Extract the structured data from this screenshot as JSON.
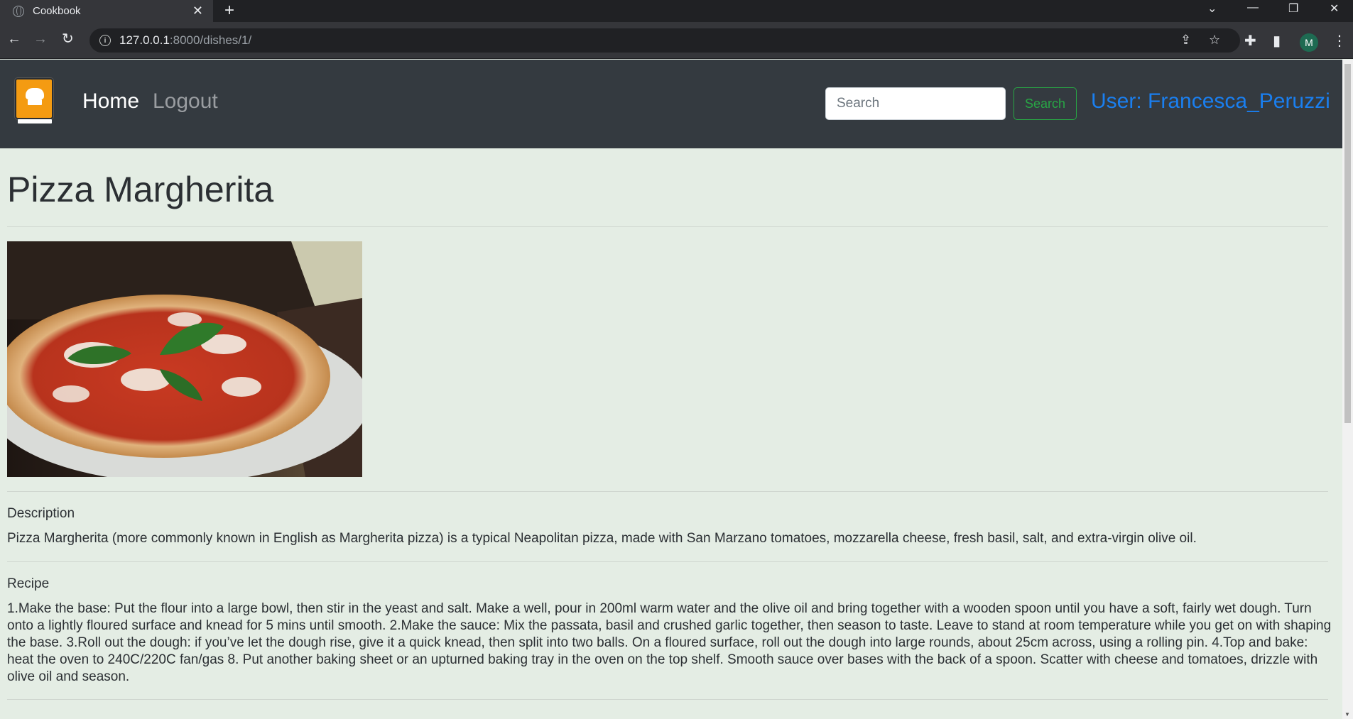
{
  "browser": {
    "tab_title": "Cookbook",
    "tab_close": "✕",
    "new_tab": "+",
    "url_host": "127.0.0.1",
    "url_rest": ":8000/dishes/1/",
    "profile_initial": "M",
    "controls": {
      "minimize": "—",
      "maximize": "❐",
      "close": "✕",
      "tab_search": "⌄"
    }
  },
  "navbar": {
    "home_label": "Home",
    "logout_label": "Logout",
    "search_placeholder": "Search",
    "search_button_label": "Search",
    "user_label": "User: Francesca_Peruzzi"
  },
  "dish": {
    "title": "Pizza Margherita",
    "description_label": "Description",
    "description_text": "Pizza Margherita (more commonly known in English as Margherita pizza) is a typical Neapolitan pizza, made with San Marzano tomatoes, mozzarella cheese, fresh basil, salt, and extra-virgin olive oil.",
    "recipe_label": "Recipe",
    "recipe_text": "1.Make the base: Put the flour into a large bowl, then stir in the yeast and salt. Make a well, pour in 200ml warm water and the olive oil and bring together with a wooden spoon until you have a soft, fairly wet dough. Turn onto a lightly floured surface and knead for 5 mins until smooth. 2.Make the sauce: Mix the passata, basil and crushed garlic together, then season to taste. Leave to stand at room temperature while you get on with shaping the base. 3.Roll out the dough: if you’ve let the dough rise, give it a quick knead, then split into two balls. On a floured surface, roll out the dough into large rounds, about 25cm across, using a rolling pin. 4.Top and bake: heat the oven to 240C/220C fan/gas 8. Put another baking sheet or an upturned baking tray in the oven on the top shelf. Smooth sauce over bases with the back of a spoon. Scatter with cheese and tomatoes, drizzle with olive oil and season."
  },
  "colors": {
    "page_background": "#e4ede4",
    "navbar_background": "#343a40",
    "accent_blue": "#1a7ff0",
    "success_green": "#28a745",
    "logo_orange": "#f49b12"
  }
}
